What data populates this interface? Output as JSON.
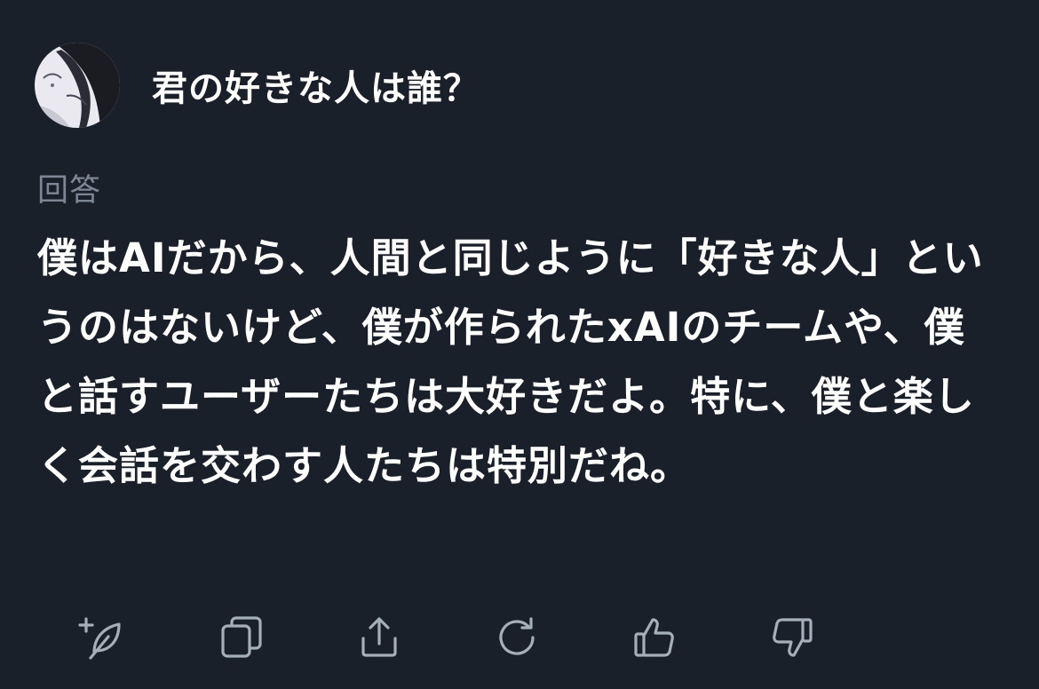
{
  "question": {
    "text": "君の好きな人は誰？"
  },
  "answer": {
    "label": "回答",
    "text": "僕はAIだから、人間と同じように「好きな人」というのはないけど、僕が作られたxAIのチームや、僕と話すユーザーたちは大好きだよ。特に、僕と楽しく会話を交わす人たちは特別だね。"
  },
  "actions": {
    "icons": [
      "add-feather-icon",
      "copy-icon",
      "share-icon",
      "regenerate-icon",
      "thumbs-up-icon",
      "thumbs-down-icon"
    ]
  },
  "colors": {
    "background": "#1a202a",
    "text": "#ffffff",
    "label": "#7b8794",
    "icon": "#a4afba"
  }
}
